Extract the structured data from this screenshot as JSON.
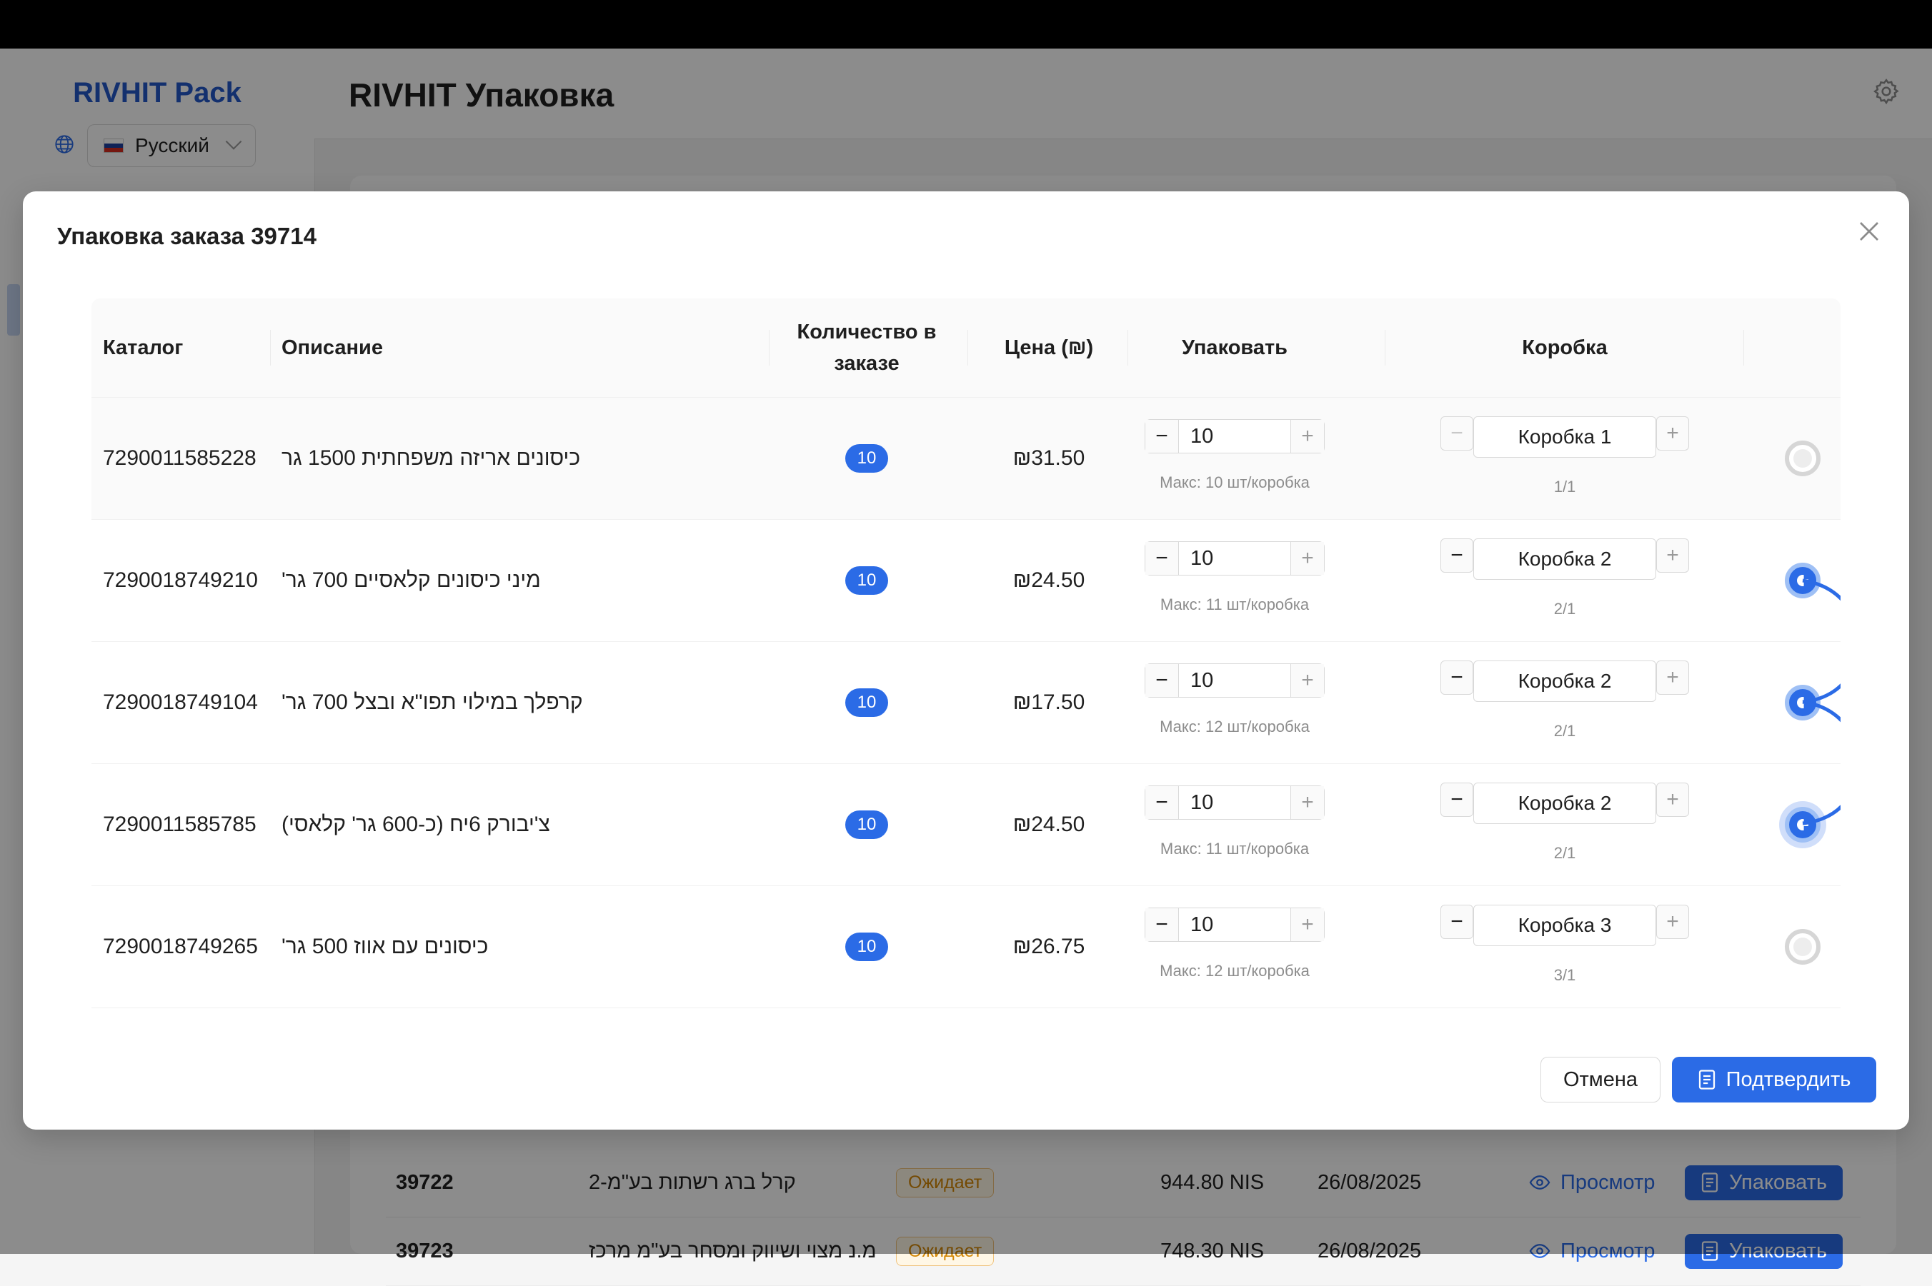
{
  "app": {
    "brand": "RIVHIT Pack",
    "title": "RIVHIT Упаковка",
    "language": "Русский"
  },
  "background_orders": [
    {
      "number": "39722",
      "client": "קרל ברג רשתות בע\"מ-2",
      "status": "Ожидает",
      "sum": "944.80 NIS",
      "date": "26/08/2025",
      "view_label": "Просмотр",
      "pack_label": "Упаковать"
    },
    {
      "number": "39723",
      "client": "מ.נ מצוי ושיווק ומסחר בע\"מ מרכז",
      "status": "Ожидает",
      "sum": "748.30 NIS",
      "date": "26/08/2025",
      "view_label": "Просмотр",
      "pack_label": "Упаковать"
    }
  ],
  "modal": {
    "title": "Упаковка заказа 39714",
    "columns": {
      "catalog": "Каталог",
      "description": "Описание",
      "qty_in_order": "Количество в заказе",
      "price": "Цена (₪)",
      "pack": "Упаковать",
      "box": "Коробка"
    },
    "rows": [
      {
        "catalog": "7290011585228",
        "description": "כיסונים אריזה משפחתית 1500 גר",
        "qty": "10",
        "price": "₪31.50",
        "pack_value": "10",
        "max_note": "Макс: 10 шт/коробка",
        "box": "Коробка 1",
        "box_note": "1/1",
        "linked": false
      },
      {
        "catalog": "7290018749210",
        "description": "מיני כיסונים קלאסיים 700 גר'",
        "qty": "10",
        "price": "₪24.50",
        "pack_value": "10",
        "max_note": "Макс: 11 шт/коробка",
        "box": "Коробка 2",
        "box_note": "2/1",
        "linked": true
      },
      {
        "catalog": "7290018749104",
        "description": "קרפלך במילוי תפו''א ובצל 700 גר'",
        "qty": "10",
        "price": "₪17.50",
        "pack_value": "10",
        "max_note": "Макс: 12 шт/коробка",
        "box": "Коробка 2",
        "box_note": "2/1",
        "linked": true
      },
      {
        "catalog": "7290011585785",
        "description": "צ'יבורק 6יח (כ-600 גר' קלאסי)",
        "qty": "10",
        "price": "₪24.50",
        "pack_value": "10",
        "max_note": "Макс: 11 шт/коробка",
        "box": "Коробка 2",
        "box_note": "2/1",
        "linked": true
      },
      {
        "catalog": "7290018749265",
        "description": "כיסונים עם אווז 500 גר'",
        "qty": "10",
        "price": "₪26.75",
        "pack_value": "10",
        "max_note": "Макс: 12 шт/коробка",
        "box": "Коробка 3",
        "box_note": "3/1",
        "linked": false
      }
    ],
    "cancel_label": "Отмена",
    "confirm_label": "Подтвердить"
  },
  "colors": {
    "accent": "#2b6be6",
    "brand": "#2458c9",
    "pending": "#d48806"
  },
  "icons": [
    "globe-icon",
    "chevron-down-icon",
    "settings-icon",
    "close-icon",
    "eye-icon",
    "document-icon",
    "link-node-icon"
  ]
}
